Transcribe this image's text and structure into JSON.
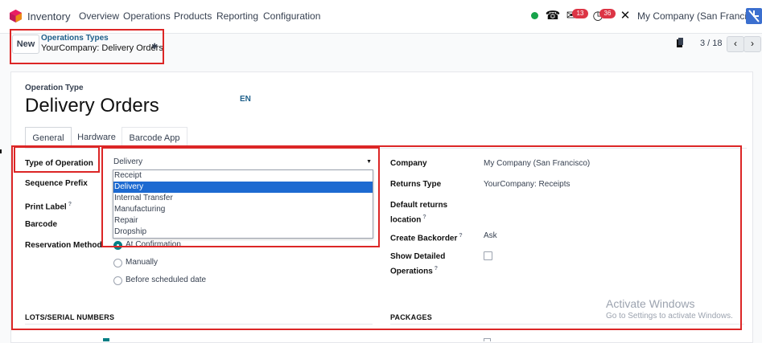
{
  "navbar": {
    "app_name": "Inventory",
    "menu": [
      "Overview",
      "Operations",
      "Products",
      "Reporting",
      "Configuration"
    ],
    "activity_badge": "13",
    "clock_badge": "36",
    "company": "My Company (San Francisco)",
    "status_color": "#16a34a",
    "icons": [
      "phone-icon",
      "chat-icon",
      "clock-icon",
      "tools-icon"
    ]
  },
  "control": {
    "new_label": "New",
    "breadcrumb_parent": "Operations Types",
    "breadcrumb_current": "YourCompany: Delivery Orders",
    "pager": "3 / 18",
    "prev": "‹",
    "next": "›"
  },
  "form": {
    "type_label": "Operation Type",
    "title": "Delivery Orders",
    "lang": "EN",
    "tabs": [
      "General",
      "Hardware",
      "Barcode App"
    ],
    "active_tab": "General",
    "left_fields": {
      "type_of_operation": "Type of Operation",
      "sequence_prefix": "Sequence Prefix",
      "print_label": "Print Label",
      "print_label_help": "?",
      "barcode": "Barcode",
      "reservation_method": "Reservation Method"
    },
    "type_of_operation_value": "Delivery",
    "dropdown_options": [
      "Receipt",
      "Delivery",
      "Internal Transfer",
      "Manufacturing",
      "Repair",
      "Dropship"
    ],
    "dropdown_selected_index": 1,
    "reservation_options": [
      "At Confirmation",
      "Manually",
      "Before scheduled date"
    ],
    "reservation_selected": 0,
    "right_fields": {
      "company_label": "Company",
      "company_value": "My Company (San Francisco)",
      "returns_type_label": "Returns Type",
      "returns_type_value": "YourCompany: Receipts",
      "default_returns_label_1": "Default returns",
      "default_returns_label_2": "location",
      "default_returns_help": "?",
      "create_backorder_label": "Create Backorder",
      "create_backorder_help": "?",
      "create_backorder_value": "Ask",
      "show_detailed_label_1": "Show Detailed",
      "show_detailed_label_2": "Operations",
      "show_detailed_help": "?",
      "show_detailed_checked": false
    },
    "sections": {
      "lots": "LOTS/SERIAL NUMBERS",
      "packages": "PACKAGES"
    }
  },
  "watermark": {
    "line1": "Activate Windows",
    "line2": "Go to Settings to activate Windows."
  },
  "highlight_color": "#dc2626"
}
